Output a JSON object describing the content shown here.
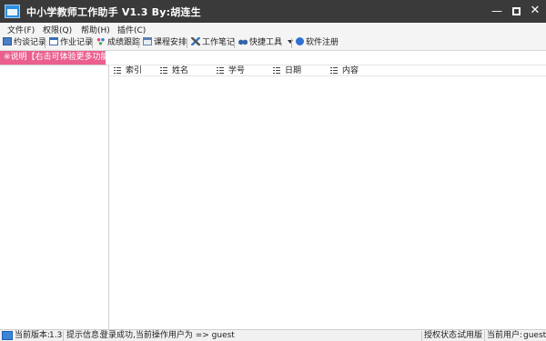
{
  "window": {
    "title": "中小学教师工作助手 V1.3  By:胡连生",
    "min_glyph": "—",
    "close_glyph": "✕"
  },
  "menu": [
    {
      "label": "文件(F)"
    },
    {
      "label": "权限(Q)"
    },
    {
      "label": "帮助(H)"
    },
    {
      "label": "插件(C)"
    }
  ],
  "toolbar": {
    "interview": "约谈记录",
    "homework": "作业记录",
    "grades": "成绩跟踪",
    "schedule": "课程安排",
    "notes": "工作笔记",
    "quick_tools": "快捷工具",
    "register": "软件注册"
  },
  "notice": "※说明【右击可体验更多功能】",
  "table": {
    "columns": [
      "索引",
      "姓名",
      "学号",
      "日期",
      "内容"
    ],
    "rows": []
  },
  "status": {
    "version_label": "当前版本:",
    "version_value": "1.3",
    "hint_label": "提示信息:",
    "hint_value": "登录成功,当前操作用户为 => guest",
    "auth_label": "授权状态:",
    "auth_value": "试用版",
    "user_label": "当前用户:",
    "user_value": "guest"
  },
  "colors": {
    "titlebar": "#3a3a3a",
    "notice_bg": "#ea5f8e",
    "accent": "#2f8fe0"
  }
}
